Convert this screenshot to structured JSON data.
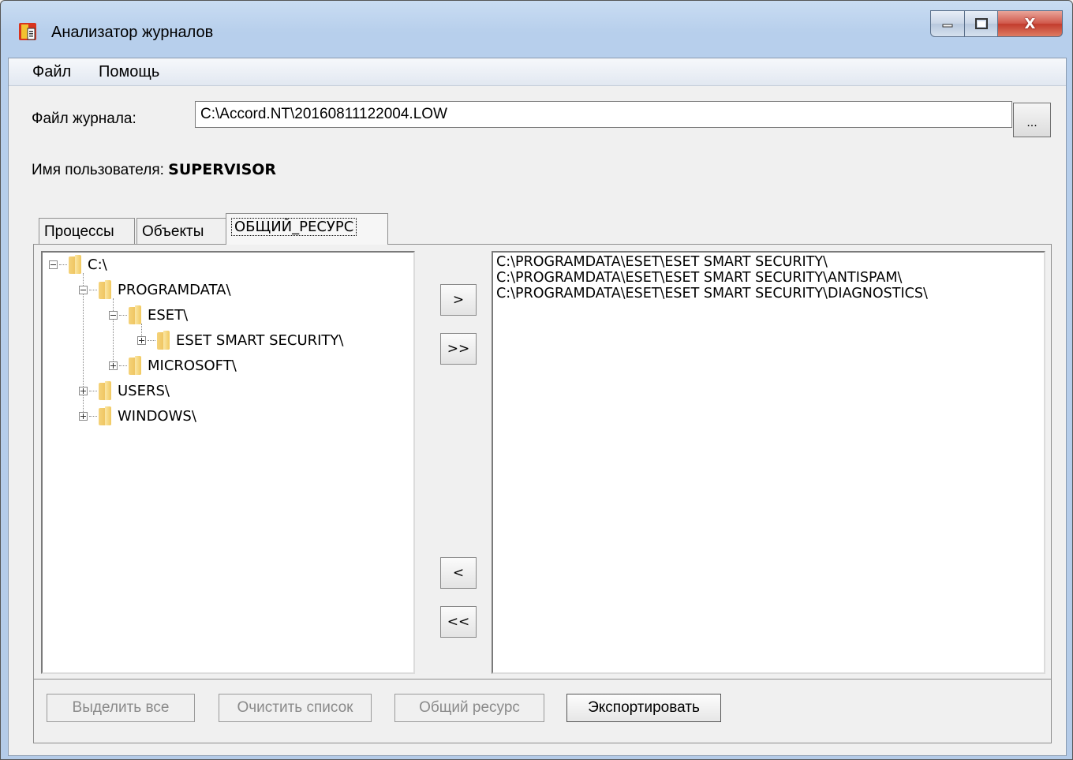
{
  "window": {
    "title": "Анализатор журналов",
    "close_symbol": "X",
    "accent": "#c23b2d"
  },
  "menu": {
    "file": "Файл",
    "help": "Помощь"
  },
  "log_file": {
    "label": "Файл журнала:",
    "value": "C:\\Accord.NT\\20160811122004.LOW",
    "browse_label": "..."
  },
  "user": {
    "label": "Имя пользователя:",
    "value": "SUPERVISOR"
  },
  "tabs": [
    {
      "label": "Процессы"
    },
    {
      "label": "Объекты"
    },
    {
      "label": "ОБЩИЙ_РЕСУРС"
    }
  ],
  "tree": {
    "nodes": [
      {
        "label": "C:\\",
        "icon": "folder-icon",
        "expander": "minus"
      },
      {
        "label": "PROGRAMDATA\\",
        "icon": "folder-icon",
        "expander": "minus"
      },
      {
        "label": "ESET\\",
        "icon": "folder-icon",
        "expander": "minus"
      },
      {
        "label": "ESET SMART SECURITY\\",
        "icon": "folder-icon",
        "expander": "plus"
      },
      {
        "label": "MICROSOFT\\",
        "icon": "folder-icon",
        "expander": "plus"
      },
      {
        "label": "USERS\\",
        "icon": "folder-icon",
        "expander": "plus"
      },
      {
        "label": "WINDOWS\\",
        "icon": "folder-icon",
        "expander": "plus"
      }
    ]
  },
  "transfer_buttons": {
    "add": ">",
    "add_all": ">>",
    "remove": "<",
    "remove_all": "<<"
  },
  "selected_list": [
    "C:\\PROGRAMDATA\\ESET\\ESET SMART SECURITY\\",
    "C:\\PROGRAMDATA\\ESET\\ESET SMART SECURITY\\ANTISPAM\\",
    "C:\\PROGRAMDATA\\ESET\\ESET SMART SECURITY\\DIAGNOSTICS\\"
  ],
  "actions": {
    "select_all": "Выделить все",
    "clear_list": "Очистить список",
    "shared_resource": "Общий ресурс",
    "export": "Экспортировать"
  }
}
